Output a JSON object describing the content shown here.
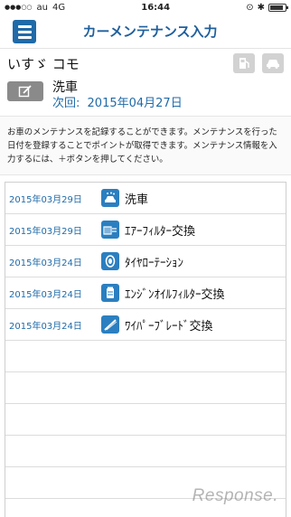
{
  "status_bar": {
    "carrier": "au",
    "network": "4G",
    "time": "16:44"
  },
  "header": {
    "title": "カーメンテナンス入力"
  },
  "car": {
    "name": "いすゞ コモ"
  },
  "next_maintenance": {
    "title": "洗車",
    "date_label": "次回:",
    "date": "2015年04月27日"
  },
  "description": "お車のメンテナンスを記録することができます。メンテナンスを行った日付を登録することでポイントが取得できます。メンテナンス情報を入力するには、＋ボタンを押してください。",
  "records": [
    {
      "date": "2015年03月29日",
      "name": "洗車",
      "icon": "car-wash-icon"
    },
    {
      "date": "2015年03月29日",
      "name": "ｴｱｰﾌｨﾙﾀｰ交換",
      "icon": "air-filter-icon"
    },
    {
      "date": "2015年03月24日",
      "name": "ﾀｲﾔﾛｰﾃｰｼｮﾝ",
      "icon": "tire-icon"
    },
    {
      "date": "2015年03月24日",
      "name": "ｴﾝｼﾞﾝｵｲﾙﾌｨﾙﾀｰ交換",
      "icon": "oil-filter-icon"
    },
    {
      "date": "2015年03月24日",
      "name": "ﾜｲﾊﾟｰﾌﾞﾚｰﾄﾞ交換",
      "icon": "wiper-icon"
    }
  ],
  "battery_level": 0.85,
  "watermark": "Response."
}
